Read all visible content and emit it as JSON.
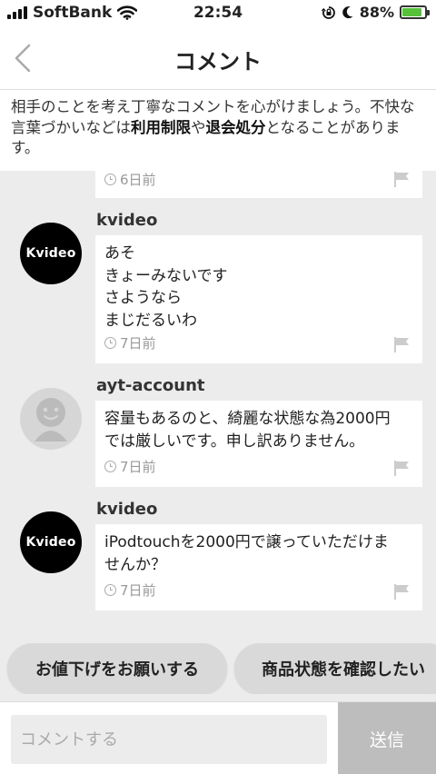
{
  "status_bar": {
    "carrier": "SoftBank",
    "time": "22:54",
    "battery": "88%",
    "battery_level": 0.88
  },
  "nav": {
    "title": "コメント"
  },
  "notice": {
    "part1": "相手のことを考え丁寧なコメントを心がけましょう。不快な言葉づかいなどは",
    "strong1": "利用制限",
    "part2": "や",
    "strong2": "退会処分",
    "part3": "となることがあります。"
  },
  "comments": [
    {
      "timestamp": "6日前"
    },
    {
      "avatar_label": "Kvideo",
      "username": "kvideo",
      "lines": [
        "あそ",
        "きょーみないです",
        "さようなら",
        "まじだるいわ"
      ],
      "timestamp": "7日前"
    },
    {
      "username": "ayt-account",
      "lines": [
        "容量もあるのと、綺麗な状態な為2000円",
        "では厳しいです。申し訳ありません。"
      ],
      "timestamp": "7日前"
    },
    {
      "avatar_label": "Kvideo",
      "username": "kvideo",
      "lines": [
        "iPodtouchを2000円で譲っていただけま",
        "せんか？"
      ],
      "timestamp": "7日前"
    }
  ],
  "quick_actions": [
    "お値下げをお願いする",
    "商品状態を確認したい"
  ],
  "input": {
    "placeholder": "コメントする",
    "send_label": "送信"
  }
}
